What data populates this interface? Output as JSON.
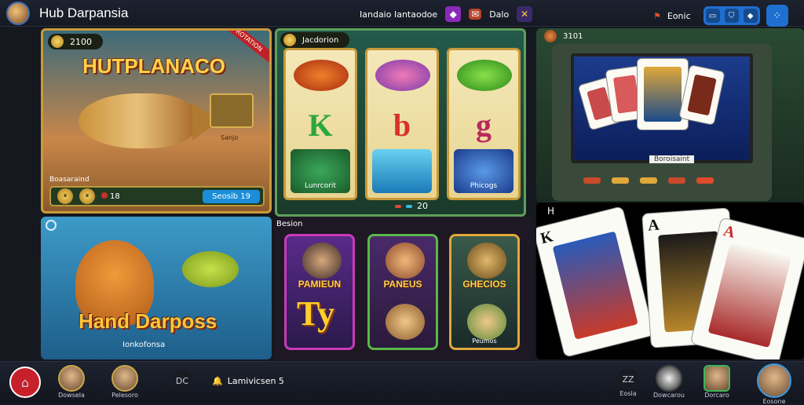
{
  "app": {
    "title": "Hub Darpansia"
  },
  "topbar": {
    "center_label": "Iandaio Iantaodoe",
    "center_item": "Dalo",
    "right_label": "Eonic"
  },
  "panels": {
    "fishing_hunt": {
      "coins": "2100",
      "ribbon": "ROTATION",
      "title": "HUTPLANACO",
      "subtitle": "Sanjo",
      "label": "Boasaraind",
      "footer_count": "18",
      "footer_button": "Seosib 19"
    },
    "slots": {
      "coins": "Jacdorion",
      "symbols": [
        "K",
        "b",
        "g"
      ],
      "reel1_bottom": "Lunrcorit",
      "reel3_bottom": "Phicogs",
      "footer_count": "20"
    },
    "arcade": {
      "coins": "3101",
      "screen_label": "Boroisaint"
    },
    "fish_boss": {
      "title": "Hand Darposs",
      "subtitle": "Ionkofonsa"
    },
    "game_list": {
      "label": "Besion",
      "cards": [
        {
          "name": "PAMIEUN",
          "sub": ""
        },
        {
          "name": "PANEUS",
          "sub": ""
        },
        {
          "name": "GHECIOS",
          "sub": "Peumos"
        }
      ],
      "symbol": "Ty"
    },
    "cards": {
      "label": "H"
    }
  },
  "bottombar": {
    "items": [
      {
        "label": "Dowsela"
      },
      {
        "label": "Pelesoro"
      },
      {
        "label": "DC"
      },
      {
        "label": "Lamivicsen 5"
      },
      {
        "label": "ZZ"
      },
      {
        "label": "Eosla"
      },
      {
        "label": "Dowcarou"
      },
      {
        "label": "Dorcaro"
      },
      {
        "label": "Eosone"
      }
    ]
  },
  "colors": {
    "accent": "#1f6fd0",
    "gold": "#ffd24a",
    "danger": "#c8202a"
  }
}
